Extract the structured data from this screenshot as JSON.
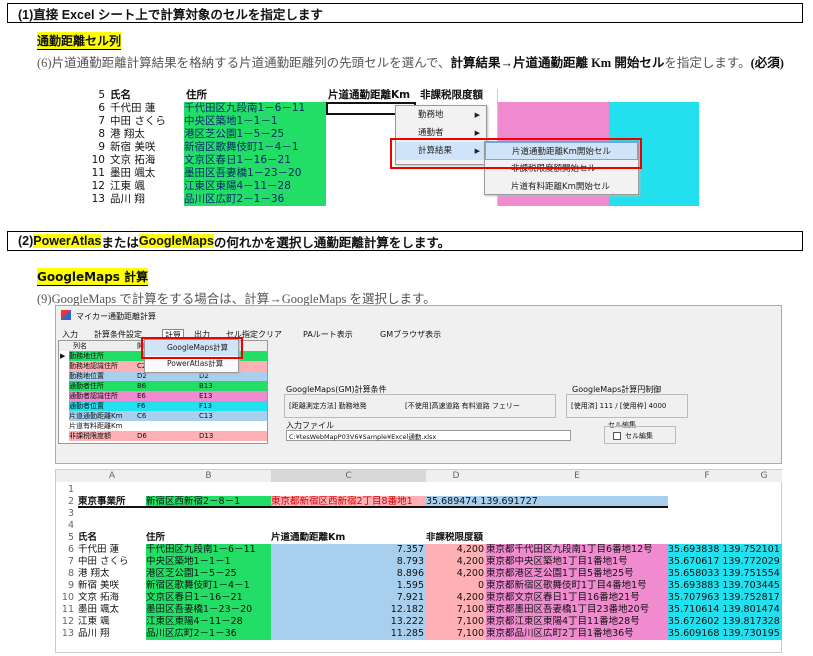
{
  "section1": {
    "heading": "(1)直接 Excel シート上で計算対象のセルを指定します",
    "subheading": "通勤距離セル列",
    "para_prefix": "(6)片道通勤距離計算結果を格納する片道通勤距離列の先頭セルを選んで、",
    "para_bold": "計算結果→片道通勤距離 Km 開始セル",
    "para_suffix": "を指定します。",
    "para_note": "(必須)",
    "grid_headers": {
      "row": "5",
      "name": "氏名",
      "addr": "住所",
      "km": "片道通勤距離Km",
      "limit": "非課税限度額"
    },
    "rows": [
      {
        "n": "6",
        "name": "千代田 蓮",
        "addr": "千代田区九段南1－6－11"
      },
      {
        "n": "7",
        "name": "中田 さくら",
        "addr": "中央区築地1－1－1"
      },
      {
        "n": "8",
        "name": "港 翔太",
        "addr": "港区芝公園1－5－25"
      },
      {
        "n": "9",
        "name": "新宿 美咲",
        "addr": "新宿区歌舞伎町1－4－1"
      },
      {
        "n": "10",
        "name": "文京 拓海",
        "addr": "文京区春日1－16－21"
      },
      {
        "n": "11",
        "name": "墨田 颯太",
        "addr": "墨田区吾妻橋1－23－20"
      },
      {
        "n": "12",
        "name": "江東 颯",
        "addr": "江東区東陽4－11－28"
      },
      {
        "n": "13",
        "name": "品川 翔",
        "addr": "品川区広町2－1－36"
      }
    ],
    "context_menu": [
      {
        "label": "勤務地",
        "arrow": "▶"
      },
      {
        "label": "通勤者",
        "arrow": "▶"
      },
      {
        "label": "計算結果",
        "arrow": "▶"
      }
    ],
    "submenu": [
      "片道通勤距離Km開始セル",
      "非課税限度額開始セル",
      "片道有料距離Km開始セル"
    ]
  },
  "section2": {
    "heading_prefix": "(2) ",
    "opt1": "PowerAtlas",
    "mid": " または ",
    "opt2": "GoogleMaps",
    "heading_suffix": " の何れかを選択し通勤距離計算をします。",
    "subheading": "GoogleMaps 計算",
    "para": "(9)GoogleMaps で計算をする場合は、計算→GoogleMaps を選択します。"
  },
  "app": {
    "title": "マイカー通勤距離計算",
    "menubar": [
      "入力",
      "計算条件設定",
      "計算",
      "出力",
      "セル指定クリア",
      "PAルート表示",
      "GMブラウザ表示"
    ],
    "dropdown": [
      "GoogleMaps計算",
      "PowerAtlas計算"
    ],
    "list_header": [
      "列名",
      "開"
    ],
    "list_rows": [
      {
        "name": "勤務地住所",
        "c1": "",
        "c2": "",
        "cls": "green"
      },
      {
        "name": "勤務地認識住所",
        "c1": "C2",
        "c2": "",
        "cls": "salmon"
      },
      {
        "name": "勤務地位置",
        "c1": "D2",
        "c2": "D2",
        "cls": "blue"
      },
      {
        "name": "通勤者住所",
        "c1": "B6",
        "c2": "B13",
        "cls": "green"
      },
      {
        "name": "通勤者認識住所",
        "c1": "E6",
        "c2": "E13",
        "cls": "pink"
      },
      {
        "name": "通勤者位置",
        "c1": "F6",
        "c2": "F13",
        "cls": "cyan"
      },
      {
        "name": "片道通勤距離Km",
        "c1": "C6",
        "c2": "C13",
        "cls": "blue"
      },
      {
        "name": "片道有料距離Km",
        "c1": "",
        "c2": "",
        "cls": "white"
      },
      {
        "name": "非課税限度額",
        "c1": "D6",
        "c2": "D13",
        "cls": "salmon"
      }
    ],
    "gm_cond_label": "GoogleMaps(GM)計算条件",
    "gm_cond_value": "[距離測定方法] 勤務地発",
    "gm_cond_value2": "[不使用]高速道路 有料道路 フェリー",
    "gm_ctrl_label": "GoogleMaps計算円制御",
    "gm_ctrl_value": "[使用済] 111 / [使用枠] 4000",
    "input_file_label": "入力ファイル",
    "input_file_value": "C:¥tesWebMapP03V6¥Sample¥Excel通勤.xlsx",
    "cell_edit_label": "セル編集",
    "cell_edit_check": "セル編集"
  },
  "sheet": {
    "cols": [
      "A",
      "B",
      "C",
      "D",
      "E",
      "F",
      "G"
    ],
    "row2": {
      "a": "東京事業所",
      "b": "新宿区西新宿2－8－1",
      "c": "東京都新宿区西新宿2丁目8番地1",
      "d": "35.689474 139.691727"
    },
    "header": {
      "a": "氏名",
      "b": "住所",
      "c": "片道通勤距離Km",
      "d": "非課税限度額"
    },
    "rows": [
      {
        "n": "6",
        "a": "千代田 蓮",
        "b": "千代田区九段南1－6－11",
        "c": "7.357",
        "d": "4,200",
        "e": "東京都千代田区九段南1丁目6番地12号",
        "f": "35.693838 139.752101"
      },
      {
        "n": "7",
        "a": "中田 さくら",
        "b": "中央区築地1－1－1",
        "c": "8.793",
        "d": "4,200",
        "e": "東京都中央区築地1丁目1番地1号",
        "f": "35.670617 139.772029"
      },
      {
        "n": "8",
        "a": "港 翔太",
        "b": "港区芝公園1－5－25",
        "c": "8.896",
        "d": "4,200",
        "e": "東京都港区芝公園1丁目5番地25号",
        "f": "35.658033 139.751554"
      },
      {
        "n": "9",
        "a": "新宿 美咲",
        "b": "新宿区歌舞伎町1－4－1",
        "c": "1.595",
        "d": "0",
        "e": "東京都新宿区歌舞伎町1丁目4番地1号",
        "f": "35.693883 139.703445"
      },
      {
        "n": "10",
        "a": "文京 拓海",
        "b": "文京区春日1－16－21",
        "c": "7.921",
        "d": "4,200",
        "e": "東京都文京区春日1丁目16番地21号",
        "f": "35.707963 139.752817"
      },
      {
        "n": "11",
        "a": "墨田 颯太",
        "b": "墨田区吾妻橋1－23－20",
        "c": "12.182",
        "d": "7,100",
        "e": "東京都墨田区吾妻橋1丁目23番地20号",
        "f": "35.710614 139.801474"
      },
      {
        "n": "12",
        "a": "江東 颯",
        "b": "江東区東陽4－11－28",
        "c": "13.222",
        "d": "7,100",
        "e": "東京都江東区東陽4丁目11番地28号",
        "f": "35.672602 139.817328"
      },
      {
        "n": "13",
        "a": "品川 翔",
        "b": "品川区広町2－1－36",
        "c": "11.285",
        "d": "7,100",
        "e": "東京都品川区広町2丁目1番地36号",
        "f": "35.609168 139.730195"
      }
    ]
  }
}
